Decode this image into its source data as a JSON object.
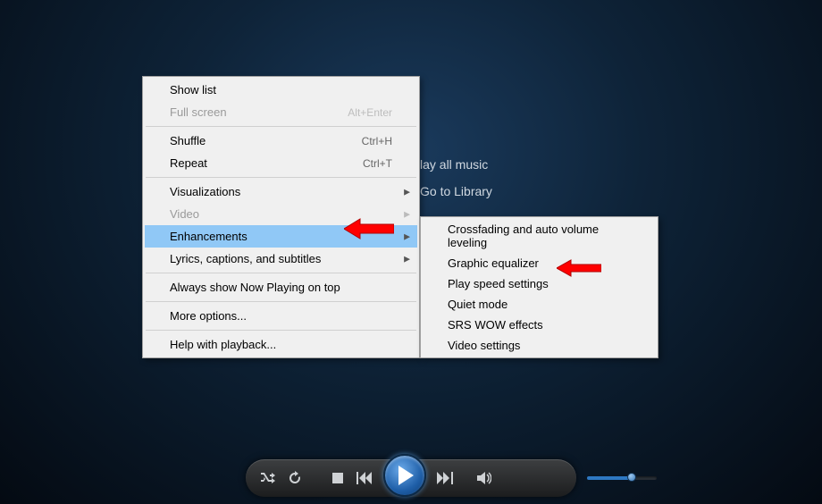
{
  "background_links": {
    "play_all": "lay all music",
    "go_library": "Go to Library"
  },
  "context_menu": {
    "show_list": "Show list",
    "full_screen": {
      "label": "Full screen",
      "shortcut": "Alt+Enter"
    },
    "shuffle": {
      "label": "Shuffle",
      "shortcut": "Ctrl+H"
    },
    "repeat": {
      "label": "Repeat",
      "shortcut": "Ctrl+T"
    },
    "visualizations": "Visualizations",
    "video": "Video",
    "enhancements": "Enhancements",
    "lyrics": "Lyrics, captions, and subtitles",
    "always_top": "Always show Now Playing on top",
    "more_options": "More options...",
    "help": "Help with playback..."
  },
  "submenu": {
    "crossfade": "Crossfading and auto volume leveling",
    "equalizer": "Graphic equalizer",
    "play_speed": "Play speed settings",
    "quiet_mode": "Quiet mode",
    "srs_wow": "SRS WOW effects",
    "video_settings": "Video settings"
  }
}
